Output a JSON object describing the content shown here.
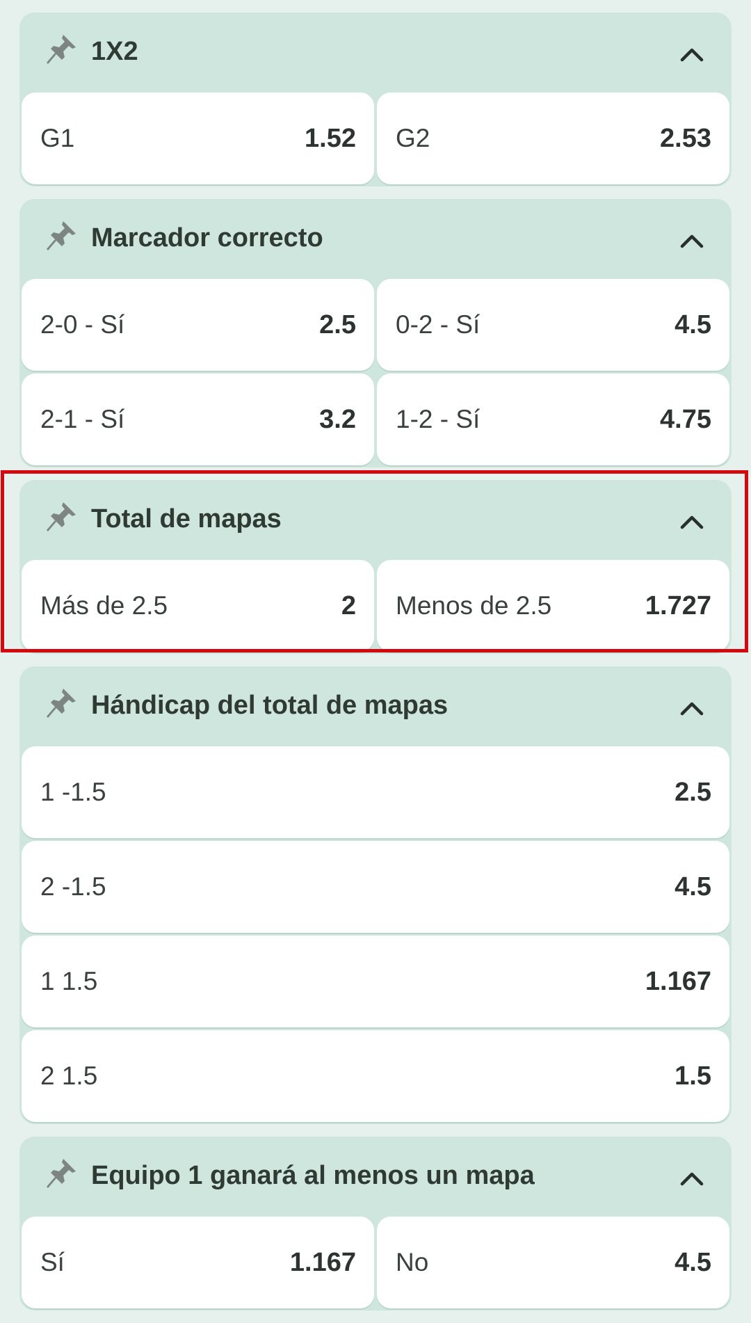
{
  "markets": [
    {
      "title": "1X2",
      "layout": "two",
      "odds": [
        {
          "label": "G1",
          "value": "1.52"
        },
        {
          "label": "G2",
          "value": "2.53"
        }
      ]
    },
    {
      "title": "Marcador correcto",
      "layout": "two",
      "odds": [
        {
          "label": "2-0 - Sí",
          "value": "2.5"
        },
        {
          "label": "0-2 - Sí",
          "value": "4.5"
        },
        {
          "label": "2-1 - Sí",
          "value": "3.2"
        },
        {
          "label": "1-2 - Sí",
          "value": "4.75"
        }
      ]
    },
    {
      "title": "Total de mapas",
      "layout": "two",
      "odds": [
        {
          "label": "Más de 2.5",
          "value": "2"
        },
        {
          "label": "Menos de 2.5",
          "value": "1.727"
        }
      ]
    },
    {
      "title": "Hándicap del total de mapas",
      "layout": "one",
      "odds": [
        {
          "label": "1 -1.5",
          "value": "2.5"
        },
        {
          "label": "2 -1.5",
          "value": "4.5"
        },
        {
          "label": "1 1.5",
          "value": "1.167"
        },
        {
          "label": "2 1.5",
          "value": "1.5"
        }
      ]
    },
    {
      "title": "Equipo 1 ganará al menos un mapa",
      "layout": "two",
      "odds": [
        {
          "label": "Sí",
          "value": "1.167"
        },
        {
          "label": "No",
          "value": "4.5"
        }
      ]
    }
  ],
  "icons": {
    "pin": "pin-icon",
    "collapse": "chevron-up-icon"
  },
  "colors": {
    "page_background": "#e6f0ec",
    "market_background": "#cfe6df",
    "odd_background": "#ffffff",
    "highlight_border": "#d4080f"
  }
}
